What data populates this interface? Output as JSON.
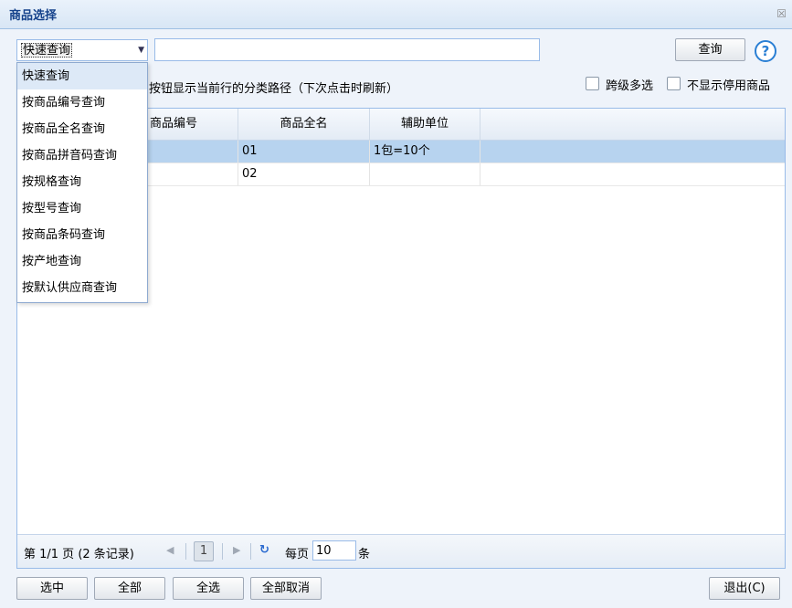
{
  "window": {
    "title": "商品选择",
    "close_glyph": "☒"
  },
  "search": {
    "mode_selected": "快速查询",
    "query_value": "",
    "query_button": "查询",
    "help_glyph": "?"
  },
  "hint_text": "按钮显示当前行的分类路径（下次点击时刷新）",
  "options": {
    "cross_level_label": "跨级多选",
    "hide_disabled_label": "不显示停用商品"
  },
  "grid": {
    "columns": [
      "商品编号",
      "商品全名",
      "辅助单位"
    ],
    "rows": [
      {
        "code": "",
        "name": "01",
        "aux_unit": "1包=10个",
        "selected": true
      },
      {
        "code": "",
        "name": "02",
        "aux_unit": "",
        "selected": false
      }
    ]
  },
  "pager": {
    "summary": "第 1/1 页 (2 条记录)",
    "current_page": "1",
    "per_page_label": "每页",
    "per_page_value": "10",
    "unit_label": "条"
  },
  "dropdown": {
    "items": [
      "快速查询",
      "按商品编号查询",
      "按商品全名查询",
      "按商品拼音码查询",
      "按规格查询",
      "按型号查询",
      "按商品条码查询",
      "按产地查询",
      "按默认供应商查询"
    ]
  },
  "footer": {
    "select_label": "选中",
    "all_label": "全部",
    "select_all_label": "全选",
    "deselect_all_label": "全部取消",
    "exit_label": "退出(C)"
  }
}
